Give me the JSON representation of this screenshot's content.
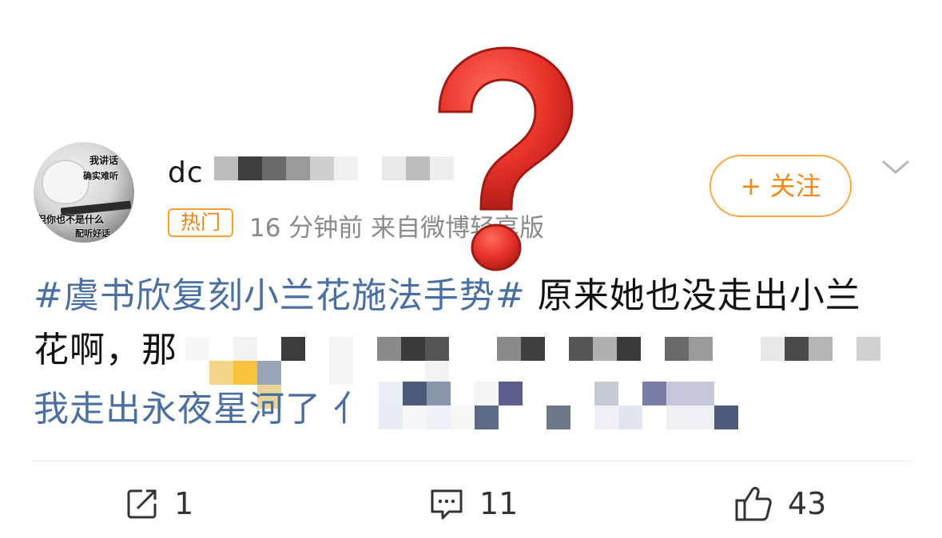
{
  "user": {
    "name_visible": "dc",
    "avatar_caption_top": "我讲话",
    "avatar_caption_mid": "确实难听",
    "avatar_caption_bottom": "但你也不是什么",
    "avatar_caption_bottom2": "配听好话"
  },
  "meta": {
    "badge": "热门",
    "time_source": "16 分钟前  来自微博轻享版"
  },
  "follow_button": {
    "label": "+ 关注"
  },
  "post": {
    "hashtag": "#虞书欣复刻小兰花施法手势#",
    "line1_rest": " 原来她也没走出小兰",
    "line2_start": "花啊，那",
    "line3_start": "我走出永夜星河了 亻"
  },
  "actions": {
    "repost_count": "1",
    "comment_count": "11",
    "like_count": "43"
  },
  "icons": {
    "repost": "share-box-icon",
    "comment": "comment-bubble-icon",
    "like": "thumbs-up-icon",
    "more": "chevron-down-icon",
    "overlay": "question-mark-icon"
  },
  "colors": {
    "accent_orange": "#f08a1c",
    "link_blue": "#4a6fa0",
    "question_red": "#e8322a"
  }
}
